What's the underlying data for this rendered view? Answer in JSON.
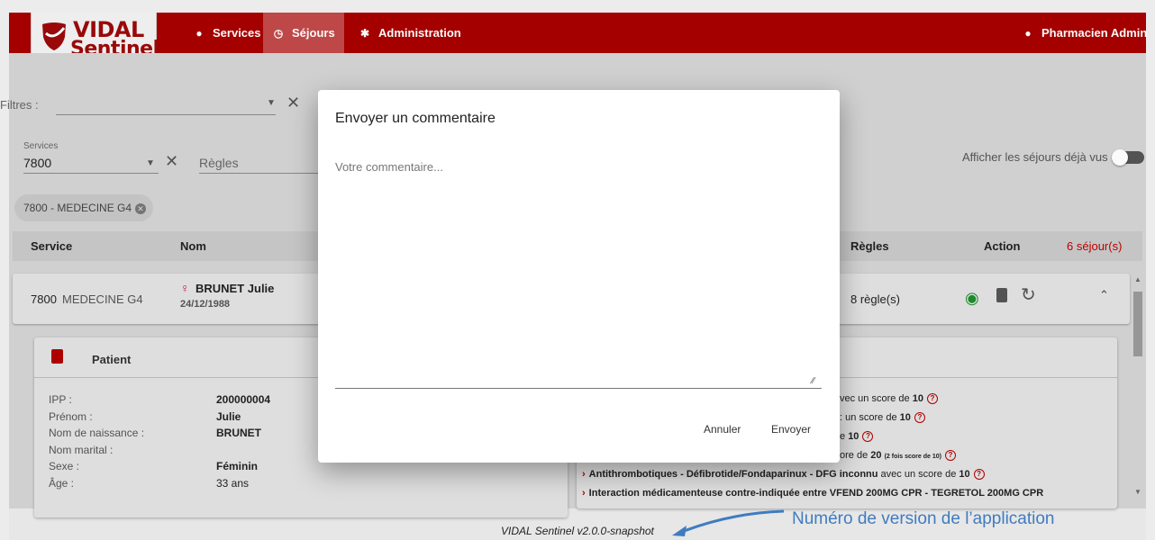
{
  "colors": {
    "brand": "#a80000",
    "nav_active": "#c24a4a",
    "accent_red": "#b30000",
    "annotation_blue": "#3f7cc0"
  },
  "logo": {
    "line1": "VIDAL",
    "line2": "Sentinel"
  },
  "nav": {
    "items": [
      {
        "label": "Services",
        "icon": "map-marker-icon"
      },
      {
        "label": "Séjours",
        "icon": "clock-icon",
        "active": true
      },
      {
        "label": "Administration",
        "icon": "gear-icon"
      }
    ],
    "user": {
      "label": "Pharmacien Admin",
      "icon": "user-icon"
    }
  },
  "filters": {
    "label": "Filtres :",
    "services_label": "Services",
    "services_value": "7800",
    "regles_placeholder": "Règles",
    "chip": "7800 - MEDECINE G4",
    "show_seen_label": "Afficher les séjours déjà vus :"
  },
  "table": {
    "headers": {
      "service": "Service",
      "nom": "Nom",
      "regles": "Règles",
      "action": "Action",
      "count": "6 séjour(s)"
    },
    "row": {
      "service_code": "7800",
      "service_name": "MEDECINE G4",
      "name": "BRUNET Julie",
      "birthdate": "24/12/1988",
      "regles": "8 règle(s)"
    }
  },
  "patient": {
    "title": "Patient",
    "fields": [
      {
        "key": "IPP :",
        "value": "200000004"
      },
      {
        "key": "Prénom :",
        "value": "Julie"
      },
      {
        "key": "Nom de naissance :",
        "value": "BRUNET"
      },
      {
        "key": "Nom marital :",
        "value": ""
      },
      {
        "key": "Sexe :",
        "value": "Féminin"
      },
      {
        "key": "Âge :",
        "value": "33 ans"
      }
    ]
  },
  "rules": {
    "r1": {
      "pre": "vec un score de ",
      "score": "10"
    },
    "r2": {
      "pre": ": un score de ",
      "score": "10"
    },
    "r3": {
      "pre": "e ",
      "score": "10"
    },
    "r4": {
      "pre": "ore de ",
      "score": "20",
      "note": "(2 fois score de 10)"
    },
    "r5": {
      "title": "Antithrombotiques - Défibrotide/Fondaparinux - DFG inconnu",
      "mid": " avec un score de ",
      "score": "10"
    },
    "r6": {
      "title": "Interaction médicamenteuse contre-indiquée entre VFEND 200MG CPR - TEGRETOL 200MG CPR"
    }
  },
  "modal": {
    "title": "Envoyer un commentaire",
    "placeholder": "Votre commentaire...",
    "value": "",
    "cancel": "Annuler",
    "send": "Envoyer"
  },
  "footer": {
    "version": "VIDAL Sentinel v2.0.0-snapshot",
    "annotation": "Numéro de version de l’application"
  }
}
